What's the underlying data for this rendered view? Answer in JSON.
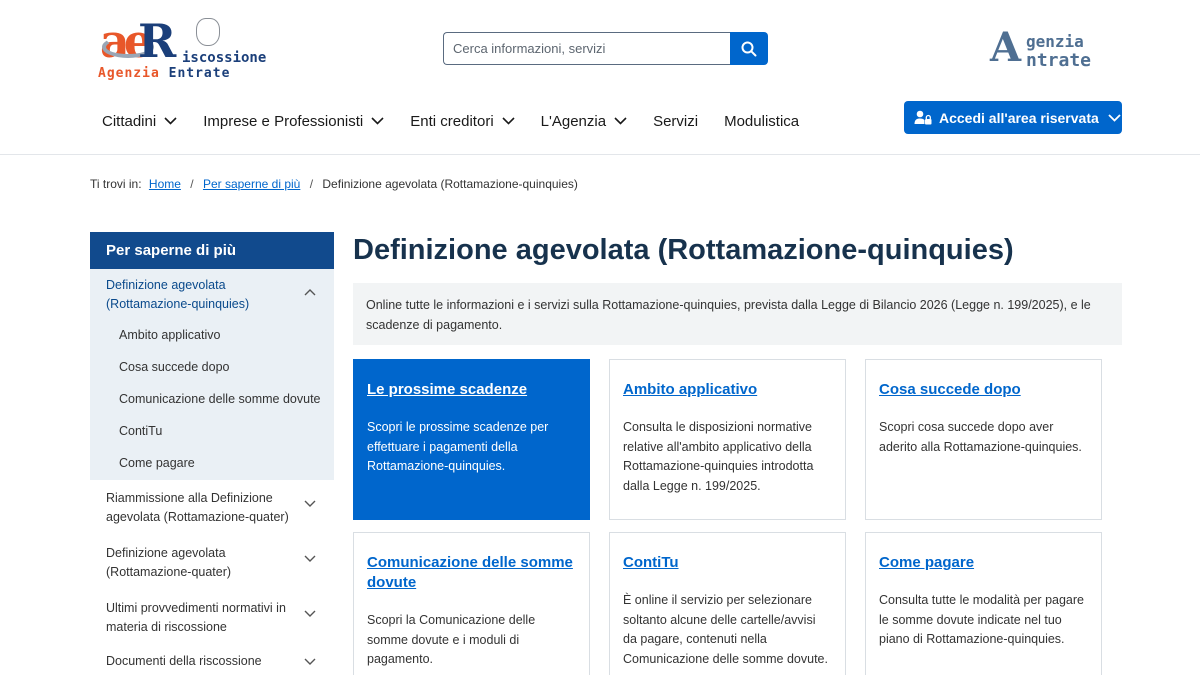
{
  "header": {
    "logo_left": {
      "mark_a": "ae",
      "mark_r": "R",
      "name": "iscossione",
      "sub_orange": "Agenzia",
      "sub_blue": "Entrate"
    },
    "search": {
      "placeholder": "Cerca informazioni, servizi",
      "icon": "search-icon"
    },
    "logo_right": {
      "mark": "A",
      "line1": "genzia",
      "line2": "ntrate"
    },
    "nav": [
      {
        "label": "Cittadini",
        "has_dropdown": true
      },
      {
        "label": "Imprese e Professionisti",
        "has_dropdown": true
      },
      {
        "label": "Enti creditori",
        "has_dropdown": true
      },
      {
        "label": "L'Agenzia",
        "has_dropdown": true
      },
      {
        "label": "Servizi",
        "has_dropdown": false
      },
      {
        "label": "Modulistica",
        "has_dropdown": false
      }
    ],
    "access_button": {
      "label": "Accedi all'area riservata",
      "icon": "user-lock-icon"
    }
  },
  "breadcrumb": {
    "prefix": "Ti trovi in:",
    "items": [
      "Home",
      "Per saperne di più",
      "Definizione agevolata (Rottamazione-quinquies)"
    ]
  },
  "sidebar": {
    "title": "Per saperne di più",
    "active": "Definizione agevolata (Rottamazione-quinquies)",
    "children": [
      "Ambito applicativo",
      "Cosa succede dopo",
      "Comunicazione delle somme dovute",
      "ContiTu",
      "Come pagare"
    ],
    "items": [
      "Riammissione alla Definizione agevolata (Rottamazione-quater)",
      "Definizione agevolata (Rottamazione-quater)",
      "Ultimi provvedimenti normativi in materia di riscossione",
      "Documenti della riscossione"
    ]
  },
  "main": {
    "title": "Definizione agevolata (Rottamazione-quinquies)",
    "intro": "Online tutte le informazioni e i servizi sulla Rottamazione-quinquies, prevista dalla Legge di Bilancio 2026 (Legge n. 199/2025), e le scadenze di pagamento.",
    "cards": [
      {
        "title": "Le prossime scadenze",
        "text": "Scopri le prossime scadenze per effettuare i pagamenti della Rottamazione-quinquies."
      },
      {
        "title": "Ambito applicativo",
        "text": "Consulta le disposizioni normative relative all'ambito applicativo della Rottamazione-quinquies introdotta dalla Legge n. 199/2025."
      },
      {
        "title": "Cosa succede dopo",
        "text": "Scopri cosa succede dopo aver aderito alla Rottamazione-quinquies."
      },
      {
        "title": "Comunicazione delle somme dovute",
        "text": "Scopri la Comunicazione delle somme dovute e i moduli di pagamento."
      },
      {
        "title": "ContiTu",
        "text": "È online il servizio per selezionare soltanto alcune delle cartelle/avvisi da pagare, contenuti nella Comunicazione delle somme dovute."
      },
      {
        "title": "Come pagare",
        "text": "Consulta tutte le modalità per pagare le somme dovute indicate nel tuo piano di Rottamazione-quinquies."
      }
    ]
  },
  "colors": {
    "primary": "#0066cc",
    "sidebar_head": "#114a8d",
    "title": "#17324d",
    "logo_orange": "#e8572a",
    "logo_blue": "#1b3f7a"
  }
}
